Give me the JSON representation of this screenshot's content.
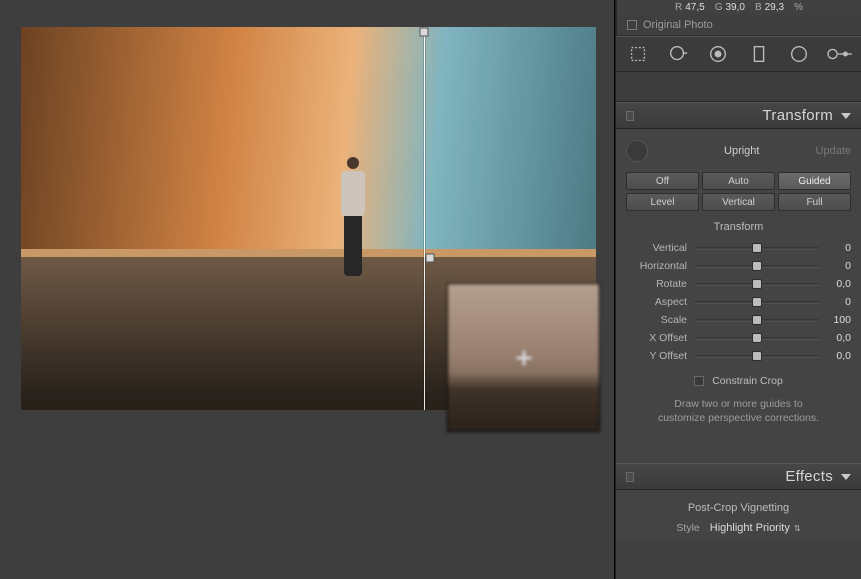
{
  "histogram": {
    "r_label": "R",
    "r_value": "47,5",
    "g_label": "G",
    "g_value": "39,0",
    "b_label": "B",
    "b_value": "29,3",
    "pct": "%",
    "original_photo": "Original Photo"
  },
  "tools": {
    "crop": "crop-icon",
    "spot": "target-icon",
    "redeye": "redeye-icon",
    "gradient": "gradient-icon",
    "radial": "radial-icon",
    "brush": "brush-icon"
  },
  "transform": {
    "panel_title": "Transform",
    "upright_label": "Upright",
    "update_label": "Update",
    "buttons": {
      "off": "Off",
      "auto": "Auto",
      "guided": "Guided",
      "level": "Level",
      "vertical": "Vertical",
      "full": "Full"
    },
    "subtitle": "Transform",
    "sliders": [
      {
        "label": "Vertical",
        "value": "0",
        "pos": 50
      },
      {
        "label": "Horizontal",
        "value": "0",
        "pos": 50
      },
      {
        "label": "Rotate",
        "value": "0,0",
        "pos": 50
      },
      {
        "label": "Aspect",
        "value": "0",
        "pos": 50
      },
      {
        "label": "Scale",
        "value": "100",
        "pos": 50
      },
      {
        "label": "X Offset",
        "value": "0,0",
        "pos": 50
      },
      {
        "label": "Y Offset",
        "value": "0,0",
        "pos": 50
      }
    ],
    "constrain_label": "Constrain Crop",
    "hint_l1": "Draw two or more guides to",
    "hint_l2": "customize perspective corrections."
  },
  "effects": {
    "panel_title": "Effects",
    "vignette_title": "Post-Crop Vignetting",
    "style_label": "Style",
    "style_value": "Highlight Priority"
  }
}
